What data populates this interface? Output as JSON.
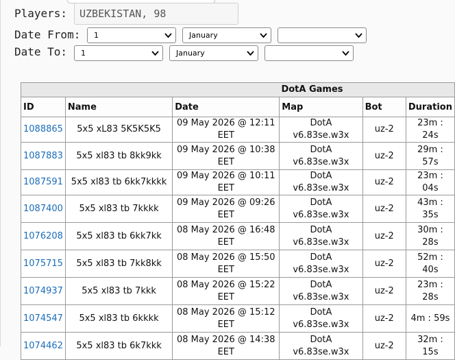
{
  "filters": {
    "players_label": "Players:",
    "players_value": "UZBEKISTAN, 98",
    "date_from_label": "Date From:",
    "date_to_label": "Date To:",
    "from": {
      "day": "1",
      "month": "January",
      "year": ""
    },
    "to": {
      "day": "1",
      "month": "January",
      "year": ""
    }
  },
  "table": {
    "caption": "DotA Games",
    "headers": {
      "id": "ID",
      "name": "Name",
      "date": "Date",
      "map": "Map",
      "bot": "Bot",
      "duration": "Duration"
    },
    "rows": [
      {
        "id": "1088865",
        "name": "5x5 xL83 5K5K5K5",
        "date": "09 May 2026 @ 12:11 EET",
        "map": "DotA v6.83se.w3x",
        "bot": "uz-2",
        "duration": "23m : 24s"
      },
      {
        "id": "1087883",
        "name": "5x5 xl83 tb 8kk9kk",
        "date": "09 May 2026 @ 10:38 EET",
        "map": "DotA v6.83se.w3x",
        "bot": "uz-2",
        "duration": "29m : 57s"
      },
      {
        "id": "1087591",
        "name": "5x5 xl83 tb 6kk7kkkk",
        "date": "09 May 2026 @ 10:11 EET",
        "map": "DotA v6.83se.w3x",
        "bot": "uz-2",
        "duration": "23m : 04s"
      },
      {
        "id": "1087400",
        "name": "5x5 xl83 tb 7kkkk",
        "date": "09 May 2026 @ 09:26 EET",
        "map": "DotA v6.83se.w3x",
        "bot": "uz-2",
        "duration": "43m : 35s"
      },
      {
        "id": "1076208",
        "name": "5x5 xl83 tb 6kk7kk",
        "date": "08 May 2026 @ 16:48 EET",
        "map": "DotA v6.83se.w3x",
        "bot": "uz-2",
        "duration": "30m : 28s"
      },
      {
        "id": "1075715",
        "name": "5x5 xl83 tb 7kk8kk",
        "date": "08 May 2026 @ 15:50 EET",
        "map": "DotA v6.83se.w3x",
        "bot": "uz-2",
        "duration": "52m : 40s"
      },
      {
        "id": "1074937",
        "name": "5x5 xl83 tb 7kkk",
        "date": "08 May 2026 @ 15:22 EET",
        "map": "DotA v6.83se.w3x",
        "bot": "uz-2",
        "duration": "23m : 28s"
      },
      {
        "id": "1074547",
        "name": "5x5 xl83 tb 6kkkk",
        "date": "08 May 2026 @ 15:12 EET",
        "map": "DotA v6.83se.w3x",
        "bot": "uz-2",
        "duration": "4m : 59s"
      },
      {
        "id": "1074462",
        "name": "5x5 xl83 tb 6k7kkk",
        "date": "08 May 2026 @ 14:38 EET",
        "map": "DotA v6.83se.w3x",
        "bot": "uz-2",
        "duration": "32m : 15s"
      }
    ]
  }
}
